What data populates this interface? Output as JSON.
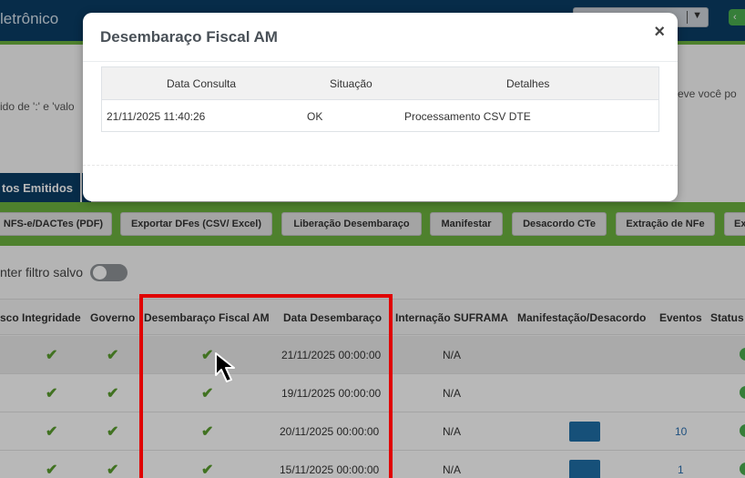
{
  "topbar": {
    "title": "letrônico",
    "select_arrow": "▼",
    "green_button": "‹"
  },
  "hints": {
    "left": "ido de ':' e 'valo",
    "right": "reve você po"
  },
  "tabs": {
    "active": "tos Emitidos"
  },
  "actions": [
    "NFS-e/DACTes (PDF)",
    "Exportar DFes (CSV/ Excel)",
    "Liberação Desembaraço",
    "Manifestar",
    "Desacordo CTe",
    "Extração de NFe",
    "Ex"
  ],
  "filter": {
    "label": "nter filtro salvo"
  },
  "grid": {
    "columns": [
      "sco",
      "Integridade",
      "Governo",
      "Desembaraço Fiscal AM",
      "Data Desembaraço",
      "Internação SUFRAMA",
      "Manifestação/Desacordo",
      "Eventos",
      "Status"
    ],
    "rows": [
      {
        "data_desembaraco": "21/11/2025 00:00:00",
        "internacao": "N/A",
        "eventos": ""
      },
      {
        "data_desembaraco": "19/11/2025 00:00:00",
        "internacao": "N/A",
        "eventos": ""
      },
      {
        "data_desembaraco": "20/11/2025 00:00:00",
        "internacao": "N/A",
        "eventos": "10"
      },
      {
        "data_desembaraco": "15/11/2025 00:00:00",
        "internacao": "N/A",
        "eventos": "1"
      }
    ],
    "check_glyph": "✔"
  },
  "modal": {
    "title": "Desembaraço Fiscal AM",
    "close": "×",
    "headers": [
      "Data Consulta",
      "Situação",
      "Detalhes"
    ],
    "row": [
      "21/11/2025 11:40:26",
      "OK",
      "Processamento CSV DTE"
    ]
  },
  "colors": {
    "navy": "#0b3d66",
    "green": "#6db33f",
    "highlight_red": "#e00000"
  }
}
